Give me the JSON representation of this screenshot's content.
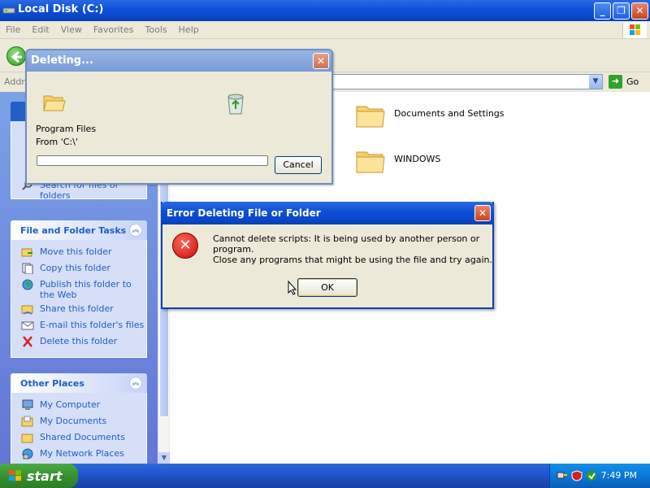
{
  "window": {
    "title": "Local Disk (C:)",
    "menu": [
      "File",
      "Edit",
      "View",
      "Favorites",
      "Tools",
      "Help"
    ],
    "address_label": "Addre",
    "go_label": "Go"
  },
  "task_pane": {
    "file_folder_tasks": {
      "title": "File and Folder Tasks",
      "items": [
        "Move this folder",
        "Copy this folder",
        "Publish this folder to the Web",
        "Share this folder",
        "E-mail this folder's files",
        "Delete this folder"
      ]
    },
    "other_places": {
      "title": "Other Places",
      "items": [
        "My Computer",
        "My Documents",
        "Shared Documents",
        "My Network Places"
      ]
    },
    "partial_search": "Search for files or folders"
  },
  "content": {
    "folders": [
      "Documents and Settings",
      "WINDOWS"
    ]
  },
  "deleting_dialog": {
    "title": "Deleting...",
    "item_name": "Program Files",
    "from_text": "From 'C:\\'",
    "cancel_label": "Cancel"
  },
  "error_dialog": {
    "title": "Error Deleting File or Folder",
    "message_line1": "Cannot delete scripts: It is being used by another person or program.",
    "message_line2": "Close any programs that might be using the file and try again.",
    "ok_label": "OK"
  },
  "taskbar": {
    "start_label": "start",
    "clock": "7:49 PM"
  },
  "colors": {
    "titlebar_blue": "#0c4fd8",
    "taskpane_link": "#215dc6",
    "error_red": "#c80a0a"
  }
}
